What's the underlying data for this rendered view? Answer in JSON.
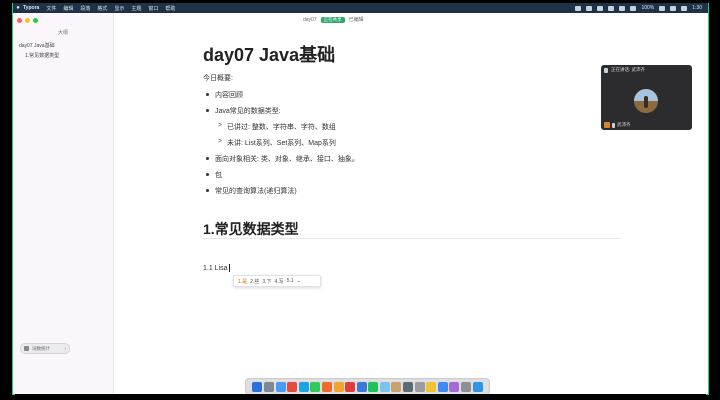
{
  "menubar": {
    "app_name": "Typora",
    "items": [
      "文件",
      "编辑",
      "段落",
      "格式",
      "显示",
      "主题",
      "窗口",
      "帮助"
    ],
    "time": "1:30",
    "battery": "100%"
  },
  "window": {
    "doc_title": "day07",
    "share_chip": "正在共享",
    "status": "已编辑"
  },
  "sidebar": {
    "outline_label": "大纲",
    "items": [
      {
        "label": "day07 Java基础",
        "level": 1
      },
      {
        "label": "1.常见数据类型",
        "level": 2
      }
    ],
    "word_count": "词数统计"
  },
  "document": {
    "title": "day07 Java基础",
    "overview_label": "今日概要:",
    "bullets": [
      "内容回顾",
      "Java常见的数据类型:",
      "面向对象相关: 类、对象、继承、接口、抽象。",
      "包",
      "常见的查询算法(递归算法)"
    ],
    "sub_items": [
      "已讲过: 整数、字符串、字符、数组",
      "未讲: List系列、Set系列、Map系列"
    ],
    "sub_marker": ">",
    "heading2": "1.常见数据类型",
    "line": "1.1 Lisa"
  },
  "ime": {
    "candidates": [
      "1.是",
      "2.些",
      "3.下",
      "4.写",
      "5.1"
    ],
    "selected_index": 0,
    "more": "⌄"
  },
  "video": {
    "caption": "正在讲话: 武沛齐",
    "participant": "武沛齐"
  },
  "dock": {
    "icon_colors": [
      "#2b6fdc",
      "#7b8895",
      "#4a9bf5",
      "#e84a3c",
      "#1aa6e0",
      "#34c759",
      "#ef6a2a",
      "#f0a52e",
      "#e23c3c",
      "#3a7bd5",
      "#1ec15a",
      "#7dc3f0",
      "#c9a36b",
      "#5d6b78",
      "#9a9aa2",
      "#f1c232",
      "#3d8bf2",
      "#a56ad9",
      "#8e8e93",
      "#2f94e8"
    ]
  }
}
